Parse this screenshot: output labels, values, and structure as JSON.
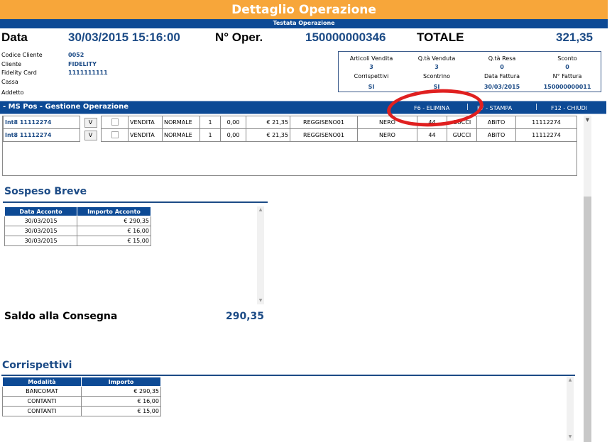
{
  "window": {
    "title": "Dettaglio Operazione",
    "subtitle": "Testata Operazione"
  },
  "header": {
    "data_label": "Data",
    "data_value": "30/03/2015 15:16:00",
    "oper_label": "N° Oper.",
    "oper_value": "150000000346",
    "totale_label": "TOTALE",
    "totale_value": "321,35"
  },
  "customer": {
    "codice_cliente_label": "Codice Cliente",
    "codice_cliente_value": "0052",
    "cliente_label": "Cliente",
    "cliente_value": "FIDELITY",
    "fidelity_card_label": "Fidelity Card",
    "fidelity_card_value": "1111111111",
    "cassa_label": "Cassa",
    "addetto_label": "Addetto"
  },
  "summary": {
    "articoli_vendita_label": "Articoli Vendita",
    "articoli_vendita_value": "3",
    "qta_venduta_label": "Q.tà Venduta",
    "qta_venduta_value": "3",
    "qta_resa_label": "Q.tà Resa",
    "qta_resa_value": "0",
    "sconto_label": "Sconto",
    "sconto_value": "0",
    "corrispettivi_label": "Corrispettivi",
    "corrispettivi_value": "SI",
    "scontrino_label": "Scontrino",
    "scontrino_value": "SI",
    "data_fattura_label": "Data Fattura",
    "data_fattura_value": "30/03/2015",
    "n_fattura_label": "N° Fattura",
    "n_fattura_value": "150000000011"
  },
  "gestione": {
    "title": "- MS Pos - Gestione Operazione",
    "f6_label": "F6 - ELIMINA",
    "f7_label": "F7 - STAMPA",
    "f12_label": "F12 - CHIUDI",
    "separator": "|"
  },
  "operations": {
    "rows": [
      {
        "code": "Int8 11112274",
        "btn": "V",
        "tipo": "VENDITA",
        "stato": "NORMALE",
        "qta": "1",
        "sconto": "0,00",
        "prezzo": "€ 21,35",
        "articolo": "REGGISENO01",
        "colore": "NERO",
        "taglia": "44",
        "marca": "GUCCI",
        "categoria": "ABITO",
        "barcode": "11112274"
      },
      {
        "code": "Int8 11112274",
        "btn": "V",
        "tipo": "VENDITA",
        "stato": "NORMALE",
        "qta": "1",
        "sconto": "0,00",
        "prezzo": "€ 21,35",
        "articolo": "REGGISENO01",
        "colore": "NERO",
        "taglia": "44",
        "marca": "GUCCI",
        "categoria": "ABITO",
        "barcode": "11112274"
      }
    ]
  },
  "sospeso": {
    "title": "Sospeso Breve",
    "col_data": "Data Acconto",
    "col_importo": "Importo Acconto",
    "rows": [
      {
        "data": "30/03/2015",
        "importo": "€ 290,35"
      },
      {
        "data": "30/03/2015",
        "importo": "€ 16,00"
      },
      {
        "data": "30/03/2015",
        "importo": "€ 15,00"
      }
    ]
  },
  "saldo": {
    "label": "Saldo alla Consegna",
    "value": "290,35"
  },
  "corrispettivi": {
    "title": "Corrispettivi",
    "col_modalita": "Modalità",
    "col_importo": "Importo",
    "rows": [
      {
        "modalita": "BANCOMAT",
        "importo": "€ 290,35"
      },
      {
        "modalita": "CONTANTI",
        "importo": "€ 16,00"
      },
      {
        "modalita": "CONTANTI",
        "importo": "€ 15,00"
      }
    ]
  },
  "colors": {
    "title_orange": "#f7a63a",
    "header_blue": "#0d4a95",
    "value_blue": "#1c4b86",
    "highlight_red": "#e02020"
  }
}
